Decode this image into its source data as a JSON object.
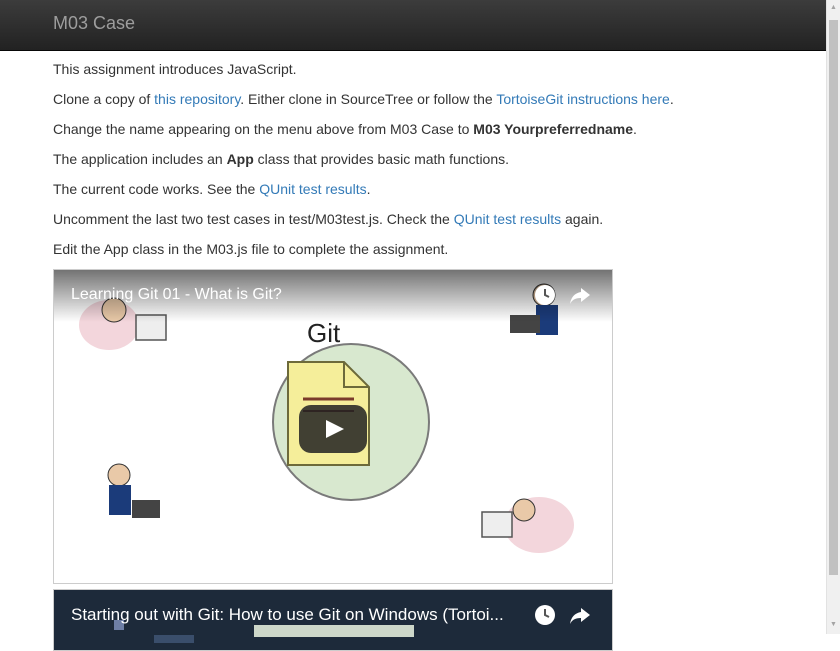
{
  "navbar": {
    "brand": "M03 Case"
  },
  "content": {
    "p1": "This assignment introduces JavaScript.",
    "p2": {
      "t1": "Clone a copy of ",
      "link1": "this repository",
      "t2": ". Either clone in SourceTree or follow the ",
      "link2": "TortoiseGit instructions here",
      "t3": "."
    },
    "p3": {
      "t1": "Change the name appearing on the menu above from M03 Case to ",
      "bold": "M03 Yourpreferredname",
      "t2": "."
    },
    "p4": {
      "t1": "The application includes an ",
      "bold": "App",
      "t2": " class that provides basic math functions."
    },
    "p5": {
      "t1": "The current code works. See the ",
      "link": "QUnit test results",
      "t2": "."
    },
    "p6": {
      "t1": "Uncomment the last two test cases in test/M03test.js. Check the ",
      "link": "QUnit test results",
      "t2": " again."
    },
    "p7": "Edit the App class in the M03.js file to complete the assignment."
  },
  "videos": [
    {
      "title": "Learning Git 01 - What is Git?",
      "thumb_label": "Git"
    },
    {
      "title": "Starting out with Git: How to use Git on Windows (Tortoi..."
    }
  ],
  "icons": {
    "clock": "clock-icon",
    "share": "share-icon",
    "play": "play-icon"
  }
}
